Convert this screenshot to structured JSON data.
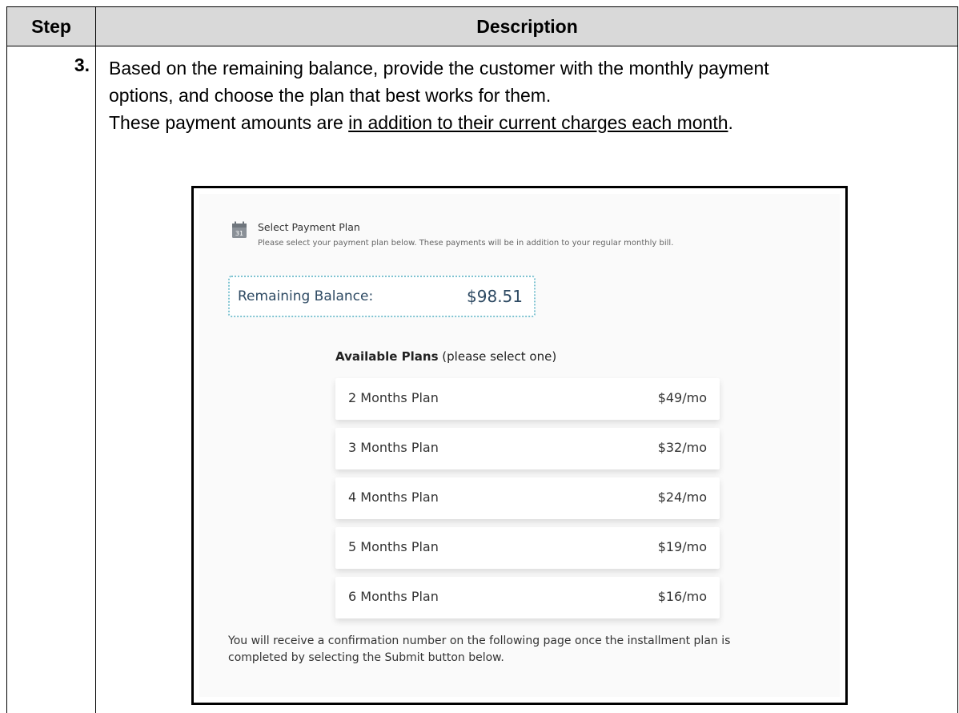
{
  "table": {
    "header_step": "Step",
    "header_description": "Description",
    "step_number": "3.",
    "line1": "Based on the remaining balance, provide the customer with the monthly payment",
    "line2": "options, and choose the plan that best works for them.",
    "line3_prefix": "These payment amounts are ",
    "line3_underlined": "in addition to their current charges each month",
    "line3_suffix": "."
  },
  "screenshot": {
    "section_title": "Select Payment Plan",
    "section_subtitle": "Please select your payment plan below. These payments will be in addition to your regular monthly bill.",
    "balance_label": "Remaining Balance:",
    "balance_value": "$98.51",
    "plans_heading_bold": "Available Plans",
    "plans_heading_note": " (please select one)",
    "plans": [
      {
        "name": "2 Months Plan",
        "price": "$49/mo"
      },
      {
        "name": "3 Months Plan",
        "price": "$32/mo"
      },
      {
        "name": "4 Months Plan",
        "price": "$24/mo"
      },
      {
        "name": "5 Months Plan",
        "price": "$19/mo"
      },
      {
        "name": "6 Months Plan",
        "price": "$16/mo"
      }
    ],
    "confirmation_line1": "You will receive a confirmation number on the following page once the installment plan is",
    "confirmation_line2": "completed by selecting the Submit button below.",
    "icons": {
      "section": "calendar-icon"
    },
    "colors": {
      "balance_text": "#2e4a63",
      "balance_border": "#7fc3d1",
      "header_bg": "#d9d9d9"
    }
  }
}
